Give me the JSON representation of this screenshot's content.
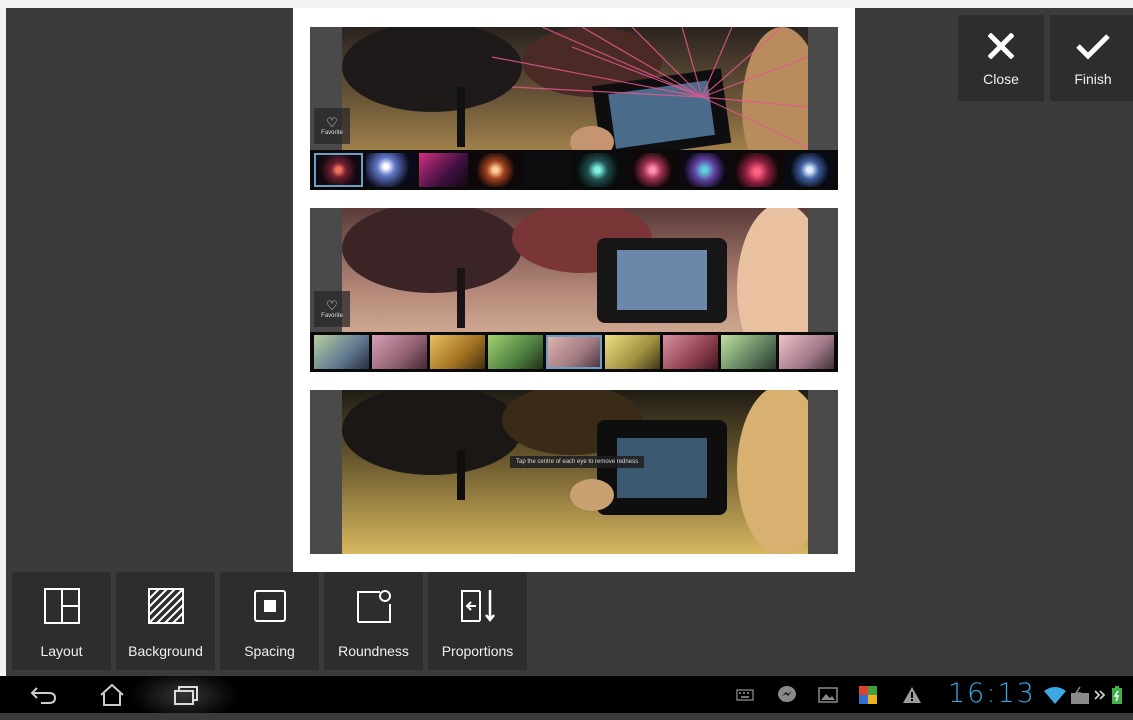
{
  "canvas": {
    "panels": [
      {
        "name": "photo-1",
        "favorite_label": "Favorite",
        "strip": "fireworks"
      },
      {
        "name": "photo-2",
        "favorite_label": "Favorite",
        "strip": "color-effects"
      },
      {
        "name": "photo-3",
        "tooltip": "Tap the centre of each eye to remove redness"
      }
    ]
  },
  "top_actions": {
    "close_label": "Close",
    "finish_label": "Finish"
  },
  "tools": [
    {
      "label": "Layout",
      "icon": "layout-icon"
    },
    {
      "label": "Background",
      "icon": "background-icon"
    },
    {
      "label": "Spacing",
      "icon": "spacing-icon"
    },
    {
      "label": "Roundness",
      "icon": "roundness-icon"
    },
    {
      "label": "Proportions",
      "icon": "proportions-icon"
    }
  ],
  "system_bar": {
    "time": "16:13",
    "clock_color": "#3ca7e0"
  },
  "colors": {
    "background": "#3b3b3b",
    "button": "#2d2d2d",
    "canvas": "#ffffff",
    "selected_outline": "#6aa0c8"
  }
}
